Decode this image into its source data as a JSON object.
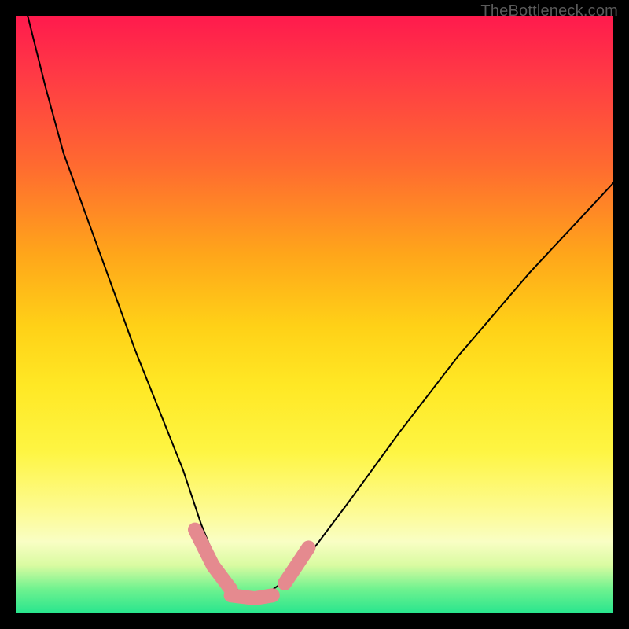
{
  "watermark": "TheBottleneck.com",
  "chart_data": {
    "type": "line",
    "title": "",
    "xlabel": "",
    "ylabel": "",
    "xlim": [
      0,
      100
    ],
    "ylim": [
      0,
      100
    ],
    "series": [
      {
        "name": "bottleneck-curve",
        "x": [
          2,
          5,
          8,
          12,
          16,
          20,
          24,
          28,
          31,
          33,
          35,
          37,
          39,
          41,
          43,
          46,
          50,
          56,
          64,
          74,
          86,
          100
        ],
        "values": [
          100,
          88,
          77,
          66,
          55,
          44,
          34,
          24,
          15,
          10,
          6,
          4,
          3,
          3,
          4,
          6,
          11,
          19,
          30,
          43,
          57,
          72
        ]
      }
    ],
    "markers": [
      {
        "name": "left-pink-line",
        "x": [
          30,
          33,
          36
        ],
        "values": [
          14,
          8,
          4
        ],
        "color": "#e58a8f"
      },
      {
        "name": "bottom-pink-line",
        "x": [
          36,
          40,
          43
        ],
        "values": [
          3,
          2.5,
          3
        ],
        "color": "#e58a8f"
      },
      {
        "name": "right-pink-line",
        "x": [
          45,
          47,
          49
        ],
        "values": [
          5,
          8,
          11
        ],
        "color": "#e58a8f"
      }
    ],
    "background_gradient": {
      "top": "#ff1a4d",
      "mid": "#ffe825",
      "bottom": "#28e58e"
    }
  }
}
